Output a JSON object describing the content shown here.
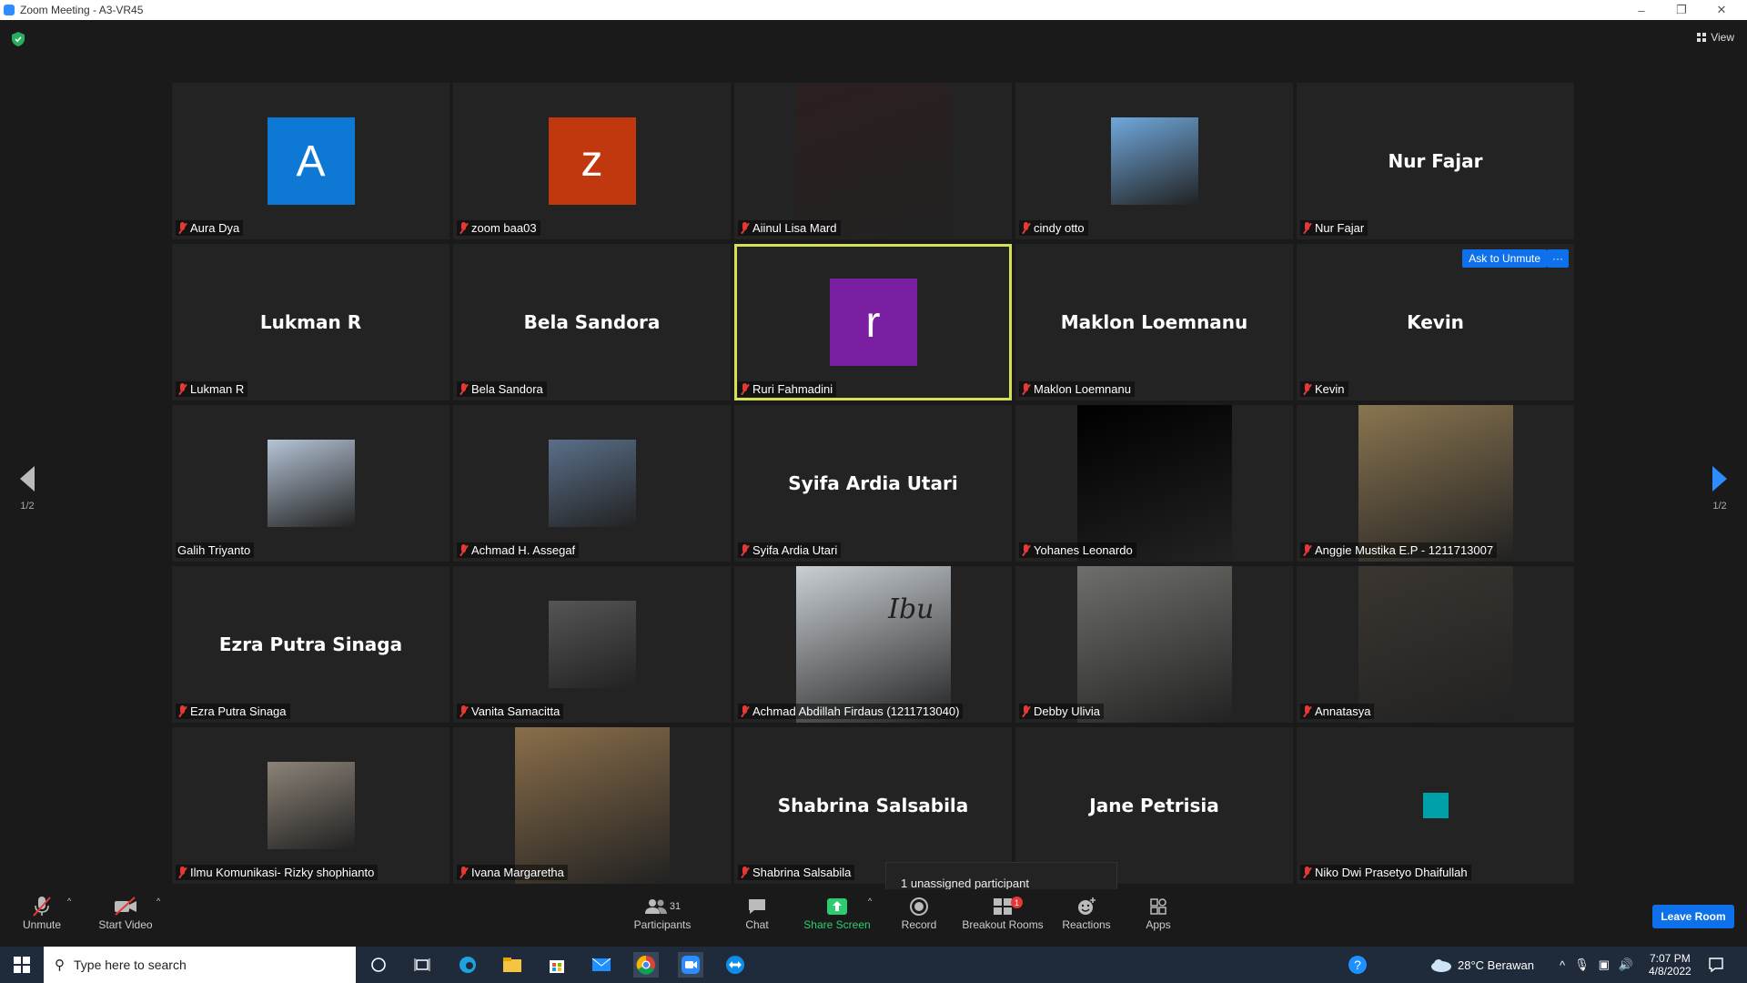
{
  "window": {
    "title": "Zoom Meeting - A3-VR45"
  },
  "view": {
    "label": "View"
  },
  "pager": {
    "left": "1/2",
    "right": "1/2"
  },
  "ask_unmute": "Ask to Unmute",
  "more_label": "···",
  "unassigned": "1 unassigned participant",
  "tiles": [
    {
      "name": "Aura Dya",
      "kind": "letter",
      "letter": "A",
      "color": "#0e78d5"
    },
    {
      "name": "zoom baa03",
      "kind": "letter",
      "letter": "z",
      "color": "#c1380e"
    },
    {
      "name": "Aiinul Lisa Mard",
      "kind": "photo",
      "color": "#2c1f1f"
    },
    {
      "name": "cindy otto",
      "kind": "photo",
      "color": "#6fa8dc"
    },
    {
      "name": "Nur Fajar",
      "kind": "text"
    },
    {
      "name": "Lukman R",
      "kind": "text"
    },
    {
      "name": "Bela Sandora",
      "kind": "text"
    },
    {
      "name": "Ruri Fahmadini",
      "kind": "letter",
      "letter": "r",
      "color": "#7b1fa2"
    },
    {
      "name": "Maklon Loemnanu",
      "kind": "text"
    },
    {
      "name": "Kevin",
      "kind": "text"
    },
    {
      "name": "Galih Triyanto",
      "kind": "photo",
      "color": "#b5c4d6"
    },
    {
      "name": "Achmad H. Assegaf",
      "kind": "photo",
      "color": "#5a6f8a"
    },
    {
      "name": "Syifa Ardia Utari",
      "kind": "text"
    },
    {
      "name": "Yohanes Leonardo",
      "kind": "photo",
      "color": "#000000"
    },
    {
      "name": "Anggie Mustika E.P - 1211713007",
      "kind": "photo",
      "color": "#8a7550"
    },
    {
      "name": "Ezra Putra Sinaga",
      "kind": "text"
    },
    {
      "name": "Vanita Samacitta",
      "kind": "photo",
      "color": "#555555"
    },
    {
      "name": "Achmad Abdillah Firdaus (1211713040)",
      "kind": "photo",
      "color": "#c9cfd4",
      "overlay": "Ibu"
    },
    {
      "name": "Debby Ulivia",
      "kind": "photo",
      "color": "#6e6f6a"
    },
    {
      "name": "Annatasya",
      "kind": "photo",
      "color": "#3a3530"
    },
    {
      "name": "Ilmu Komunikasi- Rizky shophianto",
      "kind": "photo",
      "color": "#8c8377"
    },
    {
      "name": "Ivana Margaretha",
      "kind": "photo",
      "color": "#8a6e4a"
    },
    {
      "name": "Shabrina Salsabila",
      "kind": "text"
    },
    {
      "name": "Jane Petrisia",
      "kind": "text"
    },
    {
      "name": "Niko Dwi Prasetyo Dhaifullah",
      "kind": "square",
      "color": "#00a0a8"
    }
  ],
  "toolbar": {
    "unmute": "Unmute",
    "start_video": "Start Video",
    "participants": "Participants",
    "participants_count": "31",
    "chat": "Chat",
    "share_screen": "Share Screen",
    "record": "Record",
    "breakout_rooms": "Breakout Rooms",
    "breakout_badge": "1",
    "reactions": "Reactions",
    "apps": "Apps",
    "leave": "Leave Room"
  },
  "taskbar": {
    "search_placeholder": "Type here to search",
    "weather": "28°C  Berawan",
    "time": "7:07 PM",
    "date": "4/8/2022"
  },
  "colors": {
    "accent": "#0e71eb",
    "active_border": "#d4e157",
    "muted": "#e53935",
    "share": "#2ecc71"
  }
}
